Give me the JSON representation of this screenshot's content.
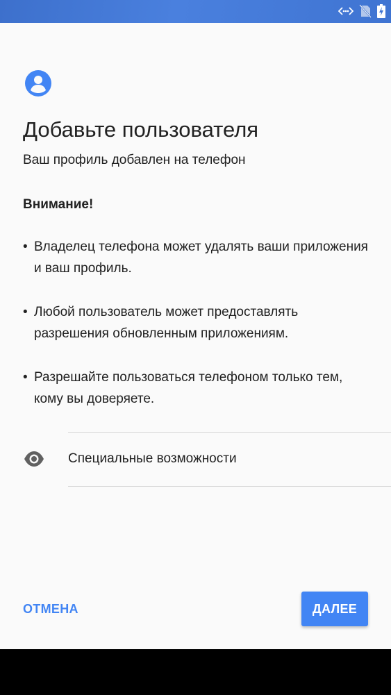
{
  "status_bar": {
    "icons": [
      "data-sync-icon",
      "no-sim-icon",
      "battery-charging-icon"
    ],
    "color": "#4a80de"
  },
  "header": {
    "icon": "account-circle-icon",
    "title": "Добавьте пользователя",
    "subtitle": "Ваш профиль добавлен на телефон"
  },
  "warning": {
    "heading": "Внимание!",
    "bullets": [
      "Владелец телефона может удалять ваши приложения и ваш профиль.",
      "Любой пользователь может предоставлять разрешения обновленным приложениям.",
      "Разрешайте пользоваться телефоном только тем, кому вы доверяете."
    ]
  },
  "accessibility": {
    "icon": "eye-icon",
    "label": "Специальные возможности"
  },
  "actions": {
    "cancel_label": "ОТМЕНА",
    "next_label": "ДАЛЕЕ"
  },
  "colors": {
    "accent": "#4285f4",
    "background": "#fafafa",
    "text": "#212121"
  }
}
